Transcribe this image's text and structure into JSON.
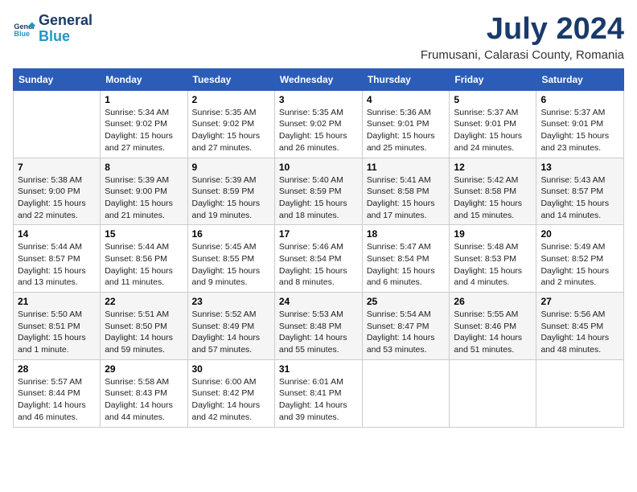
{
  "header": {
    "logo_line1": "General",
    "logo_line2": "Blue",
    "month_title": "July 2024",
    "location": "Frumusani, Calarasi County, Romania"
  },
  "days_of_week": [
    "Sunday",
    "Monday",
    "Tuesday",
    "Wednesday",
    "Thursday",
    "Friday",
    "Saturday"
  ],
  "weeks": [
    [
      {
        "day": "",
        "info": ""
      },
      {
        "day": "1",
        "info": "Sunrise: 5:34 AM\nSunset: 9:02 PM\nDaylight: 15 hours\nand 27 minutes."
      },
      {
        "day": "2",
        "info": "Sunrise: 5:35 AM\nSunset: 9:02 PM\nDaylight: 15 hours\nand 27 minutes."
      },
      {
        "day": "3",
        "info": "Sunrise: 5:35 AM\nSunset: 9:02 PM\nDaylight: 15 hours\nand 26 minutes."
      },
      {
        "day": "4",
        "info": "Sunrise: 5:36 AM\nSunset: 9:01 PM\nDaylight: 15 hours\nand 25 minutes."
      },
      {
        "day": "5",
        "info": "Sunrise: 5:37 AM\nSunset: 9:01 PM\nDaylight: 15 hours\nand 24 minutes."
      },
      {
        "day": "6",
        "info": "Sunrise: 5:37 AM\nSunset: 9:01 PM\nDaylight: 15 hours\nand 23 minutes."
      }
    ],
    [
      {
        "day": "7",
        "info": "Sunrise: 5:38 AM\nSunset: 9:00 PM\nDaylight: 15 hours\nand 22 minutes."
      },
      {
        "day": "8",
        "info": "Sunrise: 5:39 AM\nSunset: 9:00 PM\nDaylight: 15 hours\nand 21 minutes."
      },
      {
        "day": "9",
        "info": "Sunrise: 5:39 AM\nSunset: 8:59 PM\nDaylight: 15 hours\nand 19 minutes."
      },
      {
        "day": "10",
        "info": "Sunrise: 5:40 AM\nSunset: 8:59 PM\nDaylight: 15 hours\nand 18 minutes."
      },
      {
        "day": "11",
        "info": "Sunrise: 5:41 AM\nSunset: 8:58 PM\nDaylight: 15 hours\nand 17 minutes."
      },
      {
        "day": "12",
        "info": "Sunrise: 5:42 AM\nSunset: 8:58 PM\nDaylight: 15 hours\nand 15 minutes."
      },
      {
        "day": "13",
        "info": "Sunrise: 5:43 AM\nSunset: 8:57 PM\nDaylight: 15 hours\nand 14 minutes."
      }
    ],
    [
      {
        "day": "14",
        "info": "Sunrise: 5:44 AM\nSunset: 8:57 PM\nDaylight: 15 hours\nand 13 minutes."
      },
      {
        "day": "15",
        "info": "Sunrise: 5:44 AM\nSunset: 8:56 PM\nDaylight: 15 hours\nand 11 minutes."
      },
      {
        "day": "16",
        "info": "Sunrise: 5:45 AM\nSunset: 8:55 PM\nDaylight: 15 hours\nand 9 minutes."
      },
      {
        "day": "17",
        "info": "Sunrise: 5:46 AM\nSunset: 8:54 PM\nDaylight: 15 hours\nand 8 minutes."
      },
      {
        "day": "18",
        "info": "Sunrise: 5:47 AM\nSunset: 8:54 PM\nDaylight: 15 hours\nand 6 minutes."
      },
      {
        "day": "19",
        "info": "Sunrise: 5:48 AM\nSunset: 8:53 PM\nDaylight: 15 hours\nand 4 minutes."
      },
      {
        "day": "20",
        "info": "Sunrise: 5:49 AM\nSunset: 8:52 PM\nDaylight: 15 hours\nand 2 minutes."
      }
    ],
    [
      {
        "day": "21",
        "info": "Sunrise: 5:50 AM\nSunset: 8:51 PM\nDaylight: 15 hours\nand 1 minute."
      },
      {
        "day": "22",
        "info": "Sunrise: 5:51 AM\nSunset: 8:50 PM\nDaylight: 14 hours\nand 59 minutes."
      },
      {
        "day": "23",
        "info": "Sunrise: 5:52 AM\nSunset: 8:49 PM\nDaylight: 14 hours\nand 57 minutes."
      },
      {
        "day": "24",
        "info": "Sunrise: 5:53 AM\nSunset: 8:48 PM\nDaylight: 14 hours\nand 55 minutes."
      },
      {
        "day": "25",
        "info": "Sunrise: 5:54 AM\nSunset: 8:47 PM\nDaylight: 14 hours\nand 53 minutes."
      },
      {
        "day": "26",
        "info": "Sunrise: 5:55 AM\nSunset: 8:46 PM\nDaylight: 14 hours\nand 51 minutes."
      },
      {
        "day": "27",
        "info": "Sunrise: 5:56 AM\nSunset: 8:45 PM\nDaylight: 14 hours\nand 48 minutes."
      }
    ],
    [
      {
        "day": "28",
        "info": "Sunrise: 5:57 AM\nSunset: 8:44 PM\nDaylight: 14 hours\nand 46 minutes."
      },
      {
        "day": "29",
        "info": "Sunrise: 5:58 AM\nSunset: 8:43 PM\nDaylight: 14 hours\nand 44 minutes."
      },
      {
        "day": "30",
        "info": "Sunrise: 6:00 AM\nSunset: 8:42 PM\nDaylight: 14 hours\nand 42 minutes."
      },
      {
        "day": "31",
        "info": "Sunrise: 6:01 AM\nSunset: 8:41 PM\nDaylight: 14 hours\nand 39 minutes."
      },
      {
        "day": "",
        "info": ""
      },
      {
        "day": "",
        "info": ""
      },
      {
        "day": "",
        "info": ""
      }
    ]
  ]
}
